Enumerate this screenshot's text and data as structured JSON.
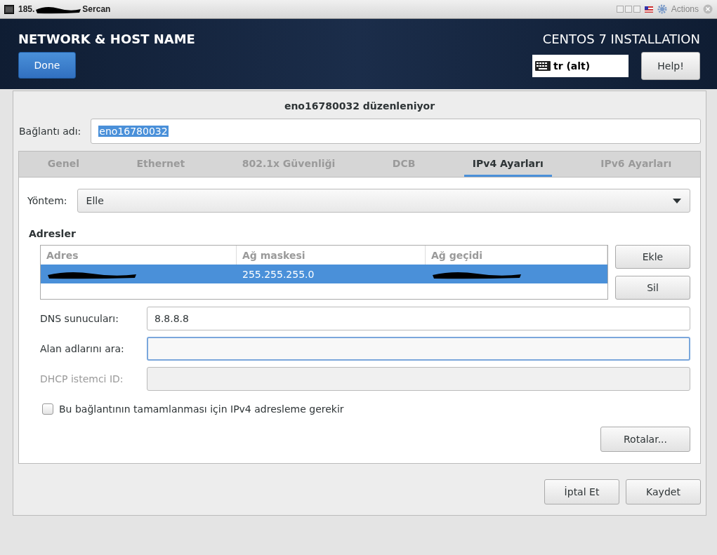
{
  "window": {
    "title_prefix": "185.",
    "title_redacted": true,
    "title_suffix": "Sercan",
    "actions": "Actions"
  },
  "header": {
    "title": "NETWORK & HOST NAME",
    "done": "Done",
    "product": "CENTOS 7 INSTALLATION",
    "keyboard": "tr (alt)",
    "help": "Help!"
  },
  "dialog": {
    "title": "eno16780032 düzenleniyor",
    "connection_label": "Bağlantı adı:",
    "connection_value": "eno16780032",
    "tabs": [
      {
        "label": "Genel",
        "selected": false
      },
      {
        "label": "Ethernet",
        "selected": false
      },
      {
        "label": "802.1x Güvenliği",
        "selected": false
      },
      {
        "label": "DCB",
        "selected": false
      },
      {
        "label": "IPv4 Ayarları",
        "selected": true
      },
      {
        "label": "IPv6 Ayarları",
        "selected": false
      }
    ],
    "method_label": "Yöntem:",
    "method_value": "Elle",
    "addresses_heading": "Adresler",
    "columns": [
      "Adres",
      "Ağ maskesi",
      "Ağ geçidi"
    ],
    "rows": [
      {
        "selected": true,
        "cells": [
          {
            "redacted": true
          },
          {
            "text": "255.255.255.0",
            "redacted": false
          },
          {
            "redacted": true
          }
        ]
      }
    ],
    "add": "Ekle",
    "remove": "Sil",
    "fields": [
      {
        "label": "DNS sunucuları:",
        "value": "8.8.8.8",
        "focused": false,
        "disabled": false
      },
      {
        "label": "Alan adlarını ara:",
        "focused": true,
        "disabled": false
      },
      {
        "label": "DHCP istemci ID:",
        "focused": false,
        "disabled": true
      }
    ],
    "checkbox": {
      "label": "Bu bağlantının tamamlanması için IPv4 adresleme gerekir",
      "checked": false
    },
    "routes": "Rotalar...",
    "cancel": "İptal Et",
    "save": "Kaydet"
  }
}
